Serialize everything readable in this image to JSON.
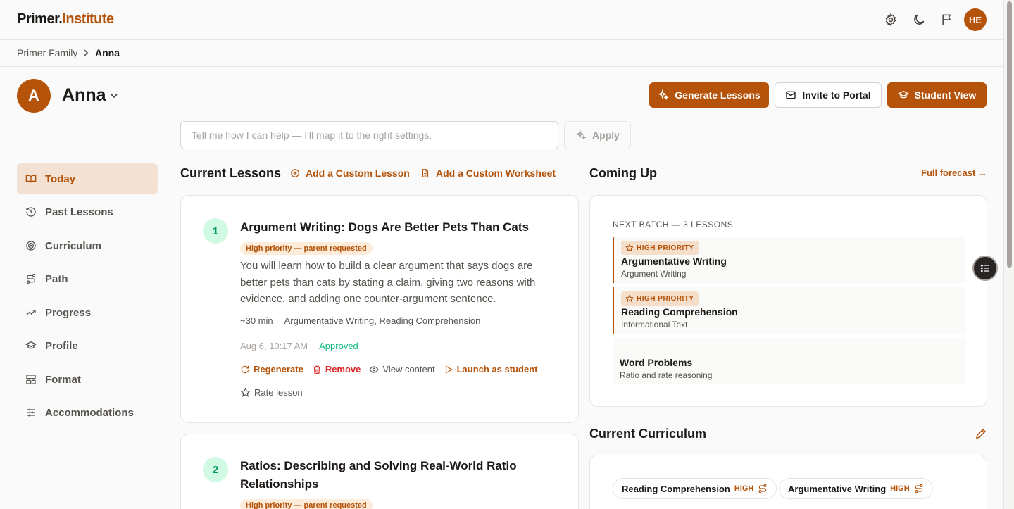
{
  "brand": {
    "name_bold": "Primer.",
    "name_accent": "Institute"
  },
  "topbar": {
    "user_initials": "HE",
    "icons": [
      "gear-icon",
      "moon-icon",
      "flag-icon"
    ]
  },
  "breadcrumb": {
    "parent": "Primer Family",
    "current": "Anna"
  },
  "student": {
    "initial": "A",
    "name": "Anna"
  },
  "header_buttons": {
    "generate": "Generate Lessons",
    "invite": "Invite to Portal",
    "student_view": "Student View"
  },
  "assistant": {
    "placeholder": "Tell me how I can help — I'll map it to the right settings.",
    "apply": "Apply"
  },
  "sidebar": {
    "items": [
      {
        "label": "Today",
        "icon": "book-open-icon",
        "active": true
      },
      {
        "label": "Past Lessons",
        "icon": "history-icon"
      },
      {
        "label": "Curriculum",
        "icon": "target-icon"
      },
      {
        "label": "Path",
        "icon": "route-icon"
      },
      {
        "label": "Progress",
        "icon": "trending-up-icon"
      },
      {
        "label": "Profile",
        "icon": "graduation-cap-icon"
      },
      {
        "label": "Format",
        "icon": "layout-icon"
      },
      {
        "label": "Accommodations",
        "icon": "sliders-icon"
      }
    ]
  },
  "current_lessons": {
    "title": "Current Lessons",
    "add_lesson": "Add a Custom Lesson",
    "add_worksheet": "Add a Custom Worksheet",
    "lessons": [
      {
        "number": "1",
        "title": "Argument Writing: Dogs Are Better Pets Than Cats",
        "priority": "High priority — parent requested",
        "description": "You will learn how to build a clear argument that says dogs are better pets than cats by stating a claim, giving two reasons with evidence, and adding one counter-argument sentence.",
        "duration": "~30 min",
        "topics": "Argumentative Writing, Reading Comprehension",
        "date": "Aug 6, 10:17 AM",
        "status": "Approved",
        "actions": {
          "regenerate": "Regenerate",
          "remove": "Remove",
          "view": "View content",
          "launch": "Launch as student",
          "rate": "Rate lesson"
        }
      },
      {
        "number": "2",
        "title": "Ratios: Describing and Solving Real-World Ratio Relationships",
        "priority": "High priority — parent requested"
      }
    ]
  },
  "coming_up": {
    "title": "Coming Up",
    "forecast_link": "Full forecast →",
    "batch_label": "NEXT BATCH — 3 LESSONS",
    "items": [
      {
        "badge": "HIGH PRIORITY",
        "title": "Argumentative Writing",
        "subtitle": "Argument Writing"
      },
      {
        "badge": "HIGH PRIORITY",
        "title": "Reading Comprehension",
        "subtitle": "Informational Text"
      },
      {
        "badge": "",
        "title": "Word Problems",
        "subtitle": "Ratio and rate reasoning"
      }
    ]
  },
  "current_curriculum": {
    "title": "Current Curriculum",
    "pills": [
      {
        "label": "Reading Comprehension",
        "level": "HIGH"
      },
      {
        "label": "Argumentative Writing",
        "level": "HIGH"
      }
    ]
  },
  "colors": {
    "accent": "#b45309",
    "approved": "#10b981",
    "remove": "#dc2626"
  }
}
